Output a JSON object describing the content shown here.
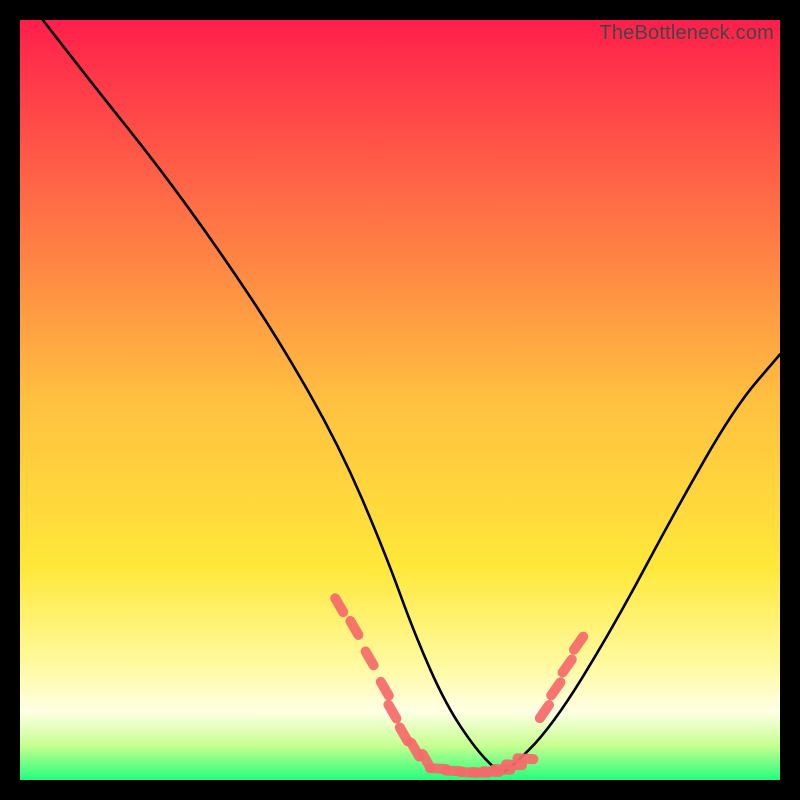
{
  "watermark": {
    "text": "TheBottleneck.com"
  },
  "chart_data": {
    "type": "line",
    "title": "",
    "xlabel": "",
    "ylabel": "",
    "xlim": [
      0,
      100
    ],
    "ylim": [
      0,
      100
    ],
    "grid": false,
    "legend": false,
    "background_gradient_stops": [
      {
        "offset": 0.0,
        "color": "#ff1f4b"
      },
      {
        "offset": 0.5,
        "color": "#ffc040"
      },
      {
        "offset": 0.72,
        "color": "#ffe83a"
      },
      {
        "offset": 0.85,
        "color": "#fffaa1"
      },
      {
        "offset": 0.91,
        "color": "#ffffe4"
      },
      {
        "offset": 0.955,
        "color": "#c6ff8f"
      },
      {
        "offset": 1.0,
        "color": "#23ff7d"
      }
    ],
    "series": [
      {
        "name": "bottleneck-curve",
        "x": [
          3,
          10,
          18,
          26,
          34,
          42,
          48,
          52,
          56,
          60,
          63,
          64,
          70,
          78,
          86,
          94,
          100
        ],
        "y": [
          100,
          91,
          81,
          70,
          58,
          44,
          30,
          19,
          10,
          4,
          1,
          1,
          7,
          20,
          35,
          49,
          56
        ]
      }
    ],
    "valley_markers": {
      "color": "#f66a6a",
      "left_cluster": {
        "x": [
          42,
          44,
          46,
          48,
          49,
          50.5,
          52,
          53.5
        ],
        "y": [
          23,
          20,
          16,
          12,
          9,
          6,
          4,
          2.5
        ]
      },
      "bottom_cluster": {
        "x": [
          55,
          57,
          59,
          60.5,
          62,
          63.5,
          65,
          66.5
        ],
        "y": [
          1.5,
          1.2,
          1.0,
          1.0,
          1.1,
          1.4,
          2.0,
          2.8
        ]
      },
      "right_cluster": {
        "x": [
          69,
          70.5,
          72,
          73.5
        ],
        "y": [
          9,
          12,
          15,
          18
        ]
      }
    }
  }
}
